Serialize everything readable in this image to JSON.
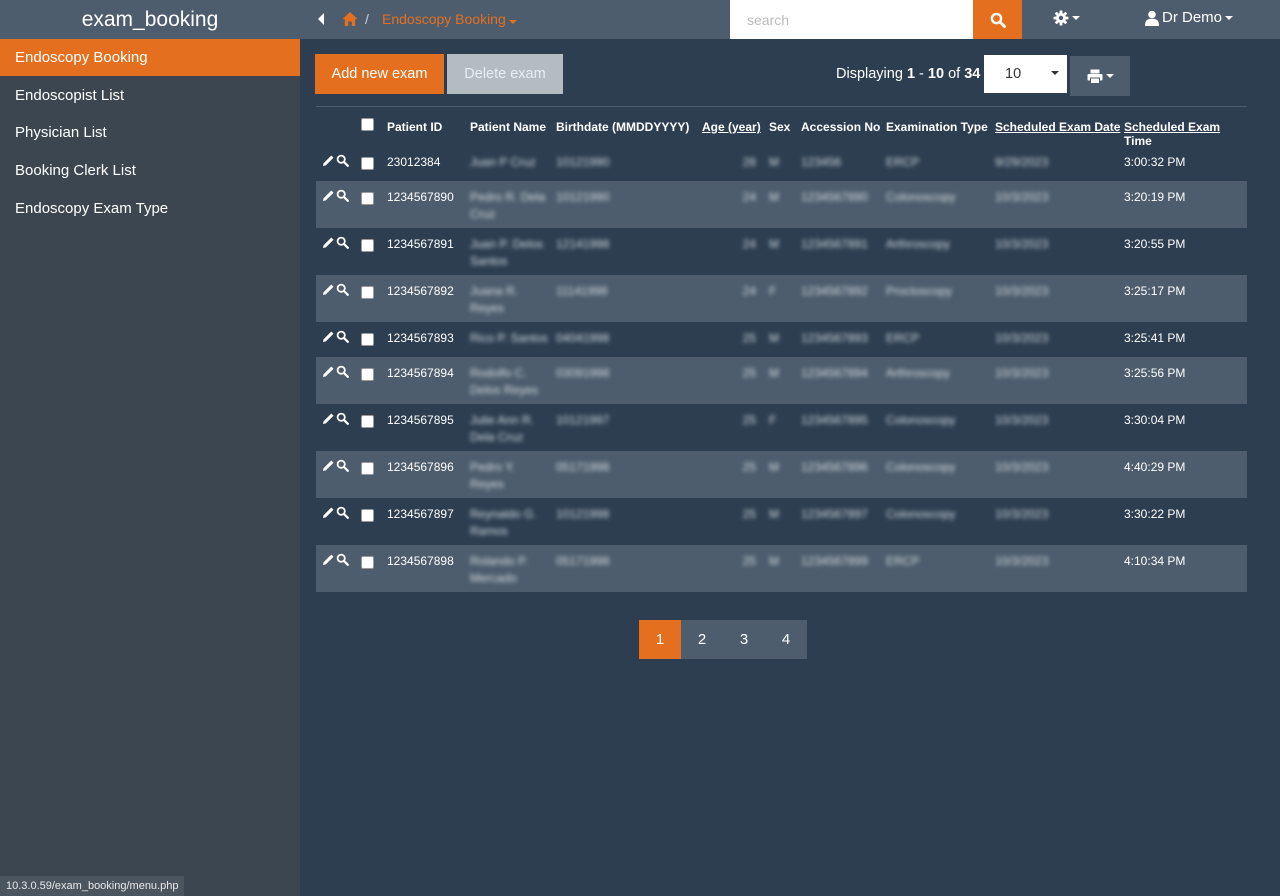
{
  "app": {
    "title": "exam_booking"
  },
  "sidebar": {
    "items": [
      {
        "label": "Endoscopy Booking"
      },
      {
        "label": "Endoscopist List"
      },
      {
        "label": "Physician List"
      },
      {
        "label": "Booking Clerk List"
      },
      {
        "label": "Endoscopy Exam Type"
      }
    ]
  },
  "breadcrumb": {
    "separator": "/",
    "current": "Endoscopy Booking"
  },
  "search": {
    "placeholder": "search"
  },
  "user": {
    "name": "Dr Demo"
  },
  "toolbar": {
    "add_label": "Add new exam",
    "delete_label": "Delete exam",
    "displaying_prefix": "Displaying",
    "range_start": "1",
    "range_dash": "-",
    "range_end": "10",
    "of": "of",
    "total": "34",
    "per_page": "10"
  },
  "table": {
    "headers": {
      "patient_id": "Patient ID",
      "patient_name": "Patient Name",
      "birthdate": "Birthdate (MMDDYYYY)",
      "age": "Age (year)",
      "sex": "Sex",
      "accession": "Accession No",
      "exam_type": "Examination Type",
      "sched_date": "Scheduled Exam Date",
      "sched_time": "Scheduled Exam Time"
    },
    "rows": [
      {
        "patient_id": "23012384",
        "name": "Juan P Cruz",
        "birthdate": "10121990",
        "age": "28",
        "sex": "M",
        "accession": "123456",
        "exam_type": "ERCP",
        "date": "9/29/2023",
        "time": "3:00:32 PM"
      },
      {
        "patient_id": "1234567890",
        "name": "Pedro R. Dela Cruz",
        "birthdate": "10121990",
        "age": "24",
        "sex": "M",
        "accession": "1234567890",
        "exam_type": "Colonoscopy",
        "date": "10/3/2023",
        "time": "3:20:19 PM"
      },
      {
        "patient_id": "1234567891",
        "name": "Juan P. Delos Santos",
        "birthdate": "12141998",
        "age": "24",
        "sex": "M",
        "accession": "1234567891",
        "exam_type": "Arthroscopy",
        "date": "10/3/2023",
        "time": "3:20:55 PM"
      },
      {
        "patient_id": "1234567892",
        "name": "Juana R. Reyes",
        "birthdate": "11141998",
        "age": "24",
        "sex": "F",
        "accession": "1234567892",
        "exam_type": "Proctoscopy",
        "date": "10/3/2023",
        "time": "3:25:17 PM"
      },
      {
        "patient_id": "1234567893",
        "name": "Rico P. Santos",
        "birthdate": "04041998",
        "age": "25",
        "sex": "M",
        "accession": "1234567893",
        "exam_type": "ERCP",
        "date": "10/3/2023",
        "time": "3:25:41 PM"
      },
      {
        "patient_id": "1234567894",
        "name": "Rodolfo C. Delos Reyes",
        "birthdate": "03091998",
        "age": "25",
        "sex": "M",
        "accession": "1234567894",
        "exam_type": "Arthroscopy",
        "date": "10/3/2023",
        "time": "3:25:56 PM"
      },
      {
        "patient_id": "1234567895",
        "name": "Julie Ann R. Dela Cruz",
        "birthdate": "10121997",
        "age": "25",
        "sex": "F",
        "accession": "1234567895",
        "exam_type": "Colonoscopy",
        "date": "10/3/2023",
        "time": "3:30:04 PM"
      },
      {
        "patient_id": "1234567896",
        "name": "Pedro Y. Reyes",
        "birthdate": "05171998",
        "age": "25",
        "sex": "M",
        "accession": "1234567896",
        "exam_type": "Colonoscopy",
        "date": "10/3/2023",
        "time": "4:40:29 PM"
      },
      {
        "patient_id": "1234567897",
        "name": "Reynaldo G. Ramos",
        "birthdate": "10121998",
        "age": "25",
        "sex": "M",
        "accession": "1234567897",
        "exam_type": "Colonoscopy",
        "date": "10/3/2023",
        "time": "3:30:22 PM"
      },
      {
        "patient_id": "1234567898",
        "name": "Rolando P. Mercado",
        "birthdate": "05171998",
        "age": "25",
        "sex": "M",
        "accession": "1234567899",
        "exam_type": "ERCP",
        "date": "10/3/2023",
        "time": "4:10:34 PM"
      }
    ]
  },
  "pagination": {
    "pages": [
      "1",
      "2",
      "3",
      "4"
    ],
    "active": "1"
  },
  "status_bar": {
    "url": "10.3.0.59/exam_booking/menu.php"
  },
  "colors": {
    "accent": "#e4701f",
    "background": "#2c3e50",
    "sidebar": "#3b4650",
    "panel": "#4d5d6d"
  },
  "icons": [
    "caret-left-icon",
    "home-icon",
    "search-icon",
    "gear-icon",
    "user-icon",
    "print-icon",
    "pencil-icon",
    "magnifier-icon"
  ]
}
